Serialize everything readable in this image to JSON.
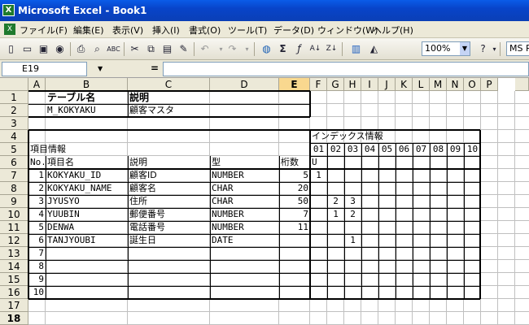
{
  "window": {
    "title": "Microsoft Excel - Book1",
    "app_icon": "excel-icon"
  },
  "menu": [
    "ファイル(F)",
    "編集(E)",
    "表示(V)",
    "挿入(I)",
    "書式(O)",
    "ツール(T)",
    "データ(D)",
    "ウィンドウ(W)",
    "ヘルプ(H)"
  ],
  "toolbar": {
    "icons": [
      "new-icon",
      "open-icon",
      "save-icon",
      "permission-icon",
      "print-icon",
      "print-preview-icon",
      "spelling-icon",
      "cut-icon",
      "copy-icon",
      "paste-icon",
      "format-painter-icon",
      "undo-icon",
      "redo-icon",
      "hyperlink-icon",
      "autosum-icon",
      "function-icon",
      "sort-ascending-icon",
      "sort-descending-icon",
      "chart-wizard-icon",
      "drawing-icon",
      "zoom-dropdown",
      "help-icon"
    ],
    "zoom": "100%",
    "font": "MS P"
  },
  "formula_bar": {
    "name_box": "E19",
    "equals": "=",
    "formula": ""
  },
  "columns": [
    "A",
    "B",
    "C",
    "D",
    "E",
    "F",
    "G",
    "H",
    "I",
    "J",
    "K",
    "L",
    "M",
    "N",
    "O",
    "P"
  ],
  "rows": [
    "1",
    "2",
    "3",
    "4",
    "5",
    "6",
    "7",
    "8",
    "9",
    "10",
    "11",
    "12",
    "13",
    "14",
    "15",
    "16",
    "17",
    "18"
  ],
  "cells": {
    "B1": "テーブル名",
    "C1": "説明",
    "B2": "M_KOKYAKU",
    "C2": "顧客マスタ",
    "F4": "インデックス情報",
    "A5": "項目情報",
    "F5": "01",
    "G5": "02",
    "H5": "03",
    "I5": "04",
    "J5": "05",
    "K5": "06",
    "L5": "07",
    "M5": "08",
    "N5": "09",
    "O5": "10",
    "A6": "No.",
    "B6": "項目名",
    "C6": "説明",
    "D6": "型",
    "E6": "桁数",
    "F6": "U",
    "A7": "1",
    "B7": "KOKYAKU_ID",
    "C7": "顧客ID",
    "D7": "NUMBER",
    "E7": "5",
    "F7": "1",
    "A8": "2",
    "B8": "KOKYAKU_NAME",
    "C8": "顧客名",
    "D8": "CHAR",
    "E8": "20",
    "A9": "3",
    "B9": "JYUSYO",
    "C9": "住所",
    "D9": "CHAR",
    "E9": "50",
    "G9": "2",
    "H9": "3",
    "A10": "4",
    "B10": "YUUBIN",
    "C10": "郵便番号",
    "D10": "NUMBER",
    "E10": "7",
    "G10": "1",
    "H10": "2",
    "A11": "5",
    "B11": "DENWA",
    "C11": "電話番号",
    "D11": "NUMBER",
    "E11": "11",
    "A12": "6",
    "B12": "TANJYOUBI",
    "C12": "誕生日",
    "D12": "DATE",
    "H12": "1",
    "A13": "7",
    "A14": "8",
    "A15": "9",
    "A16": "10"
  }
}
